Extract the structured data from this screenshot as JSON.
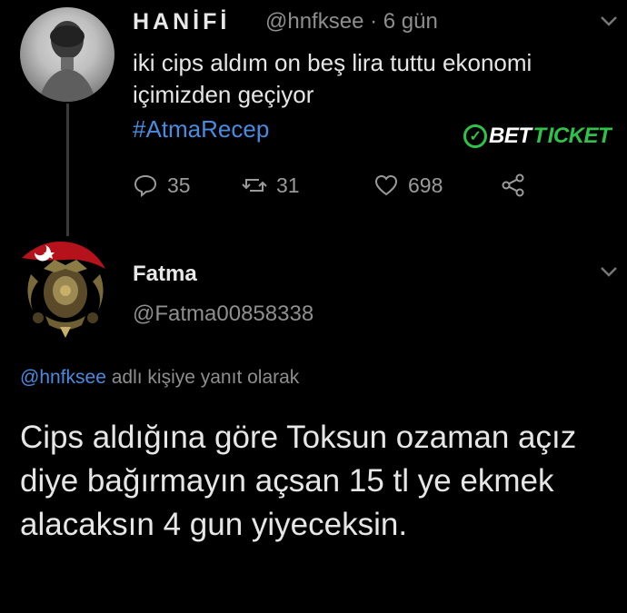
{
  "tweet1": {
    "display_name": "HANİFİ",
    "handle": "@hnfksee",
    "time": "· 6 gün",
    "text": "iki cips aldım on beş lira tuttu ekonomi içimizden geçiyor",
    "hashtag": "#AtmaRecep",
    "badge": {
      "part1": "BET",
      "part2": "ICKET",
      "prefix": "T"
    },
    "replies": "35",
    "retweets": "31",
    "likes": "698"
  },
  "tweet2": {
    "display_name": "Fatma",
    "handle": "@Fatma00858338",
    "reply_to_handle": "@hnfksee",
    "reply_to_suffix": " adlı kişiye yanıt olarak",
    "text": "Cips aldığına göre Toksun ozaman açız diye bağırmayın açsan 15 tl ye ekmek alacaksın 4 gun yiyeceksin."
  },
  "colors": {
    "link": "#4a8be0",
    "muted": "#8e8e8e",
    "brand_green": "#2fc24a",
    "background": "#000000"
  }
}
